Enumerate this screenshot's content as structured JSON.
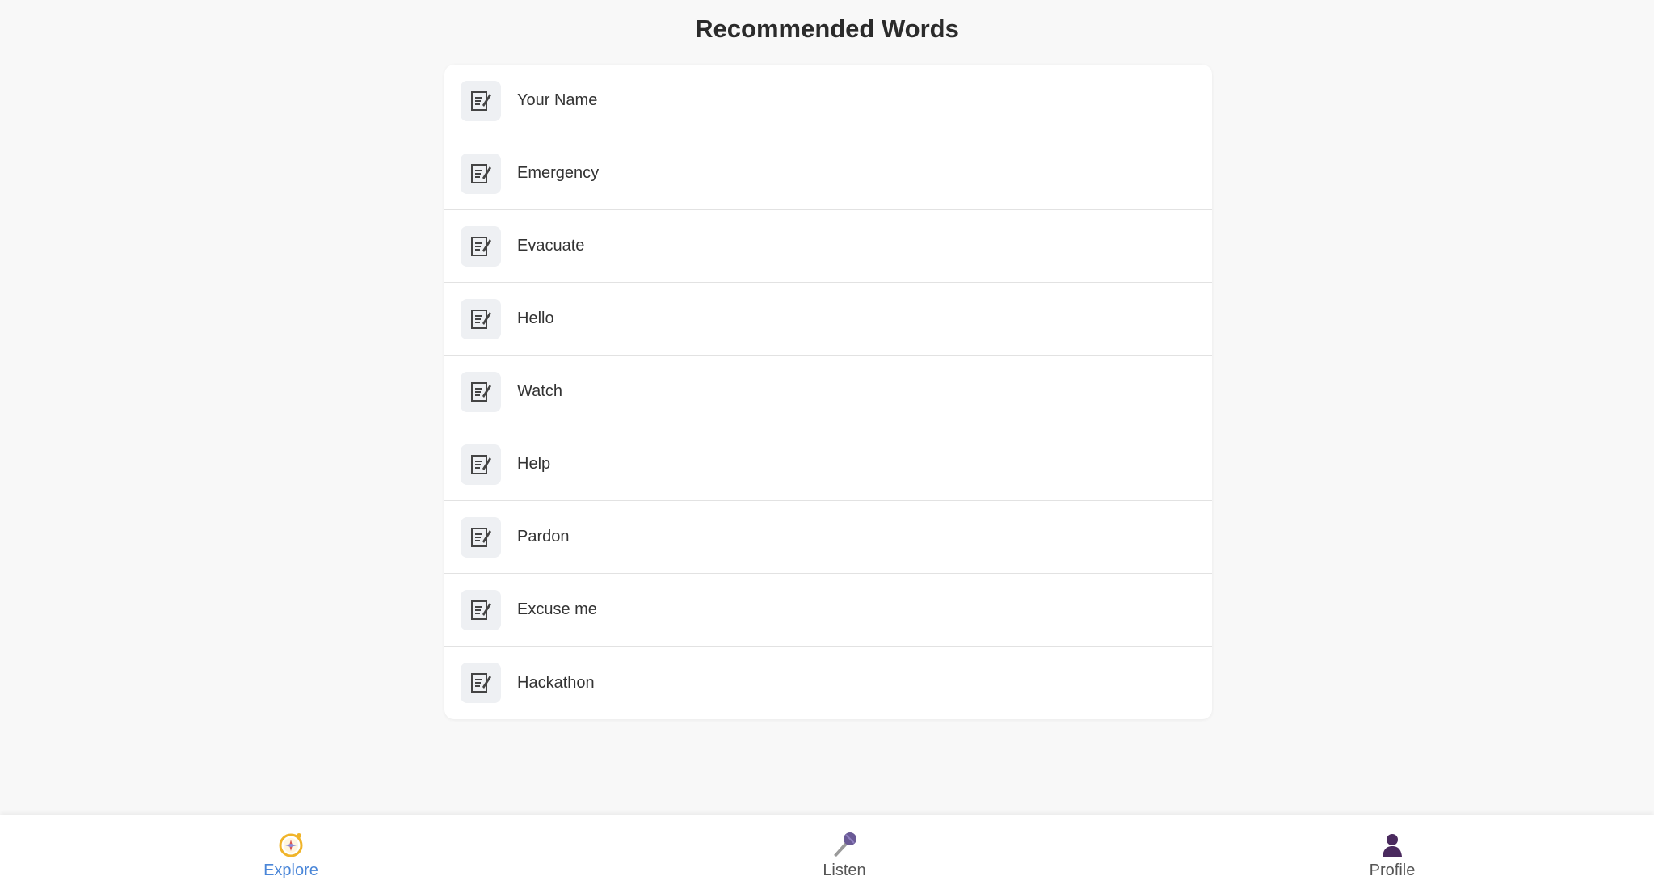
{
  "page": {
    "title": "Recommended Words"
  },
  "words": [
    {
      "label": "Your Name",
      "icon": "edit-note-icon"
    },
    {
      "label": "Emergency",
      "icon": "edit-note-icon"
    },
    {
      "label": "Evacuate",
      "icon": "edit-note-icon"
    },
    {
      "label": "Hello",
      "icon": "edit-note-icon"
    },
    {
      "label": "Watch",
      "icon": "edit-note-icon"
    },
    {
      "label": "Help",
      "icon": "edit-note-icon"
    },
    {
      "label": "Pardon",
      "icon": "edit-note-icon"
    },
    {
      "label": "Excuse me",
      "icon": "edit-note-icon"
    },
    {
      "label": "Hackathon",
      "icon": "edit-note-icon"
    }
  ],
  "nav": {
    "items": [
      {
        "label": "Explore",
        "icon": "compass-icon",
        "active": true
      },
      {
        "label": "Listen",
        "icon": "microphone-icon",
        "active": false
      },
      {
        "label": "Profile",
        "icon": "person-icon",
        "active": false
      }
    ]
  },
  "colors": {
    "background": "#f8f8f8",
    "active_nav": "#4a86d8",
    "compass": "#f0b429",
    "microphone": "#7b6aa6",
    "profile": "#4a2a5e"
  }
}
